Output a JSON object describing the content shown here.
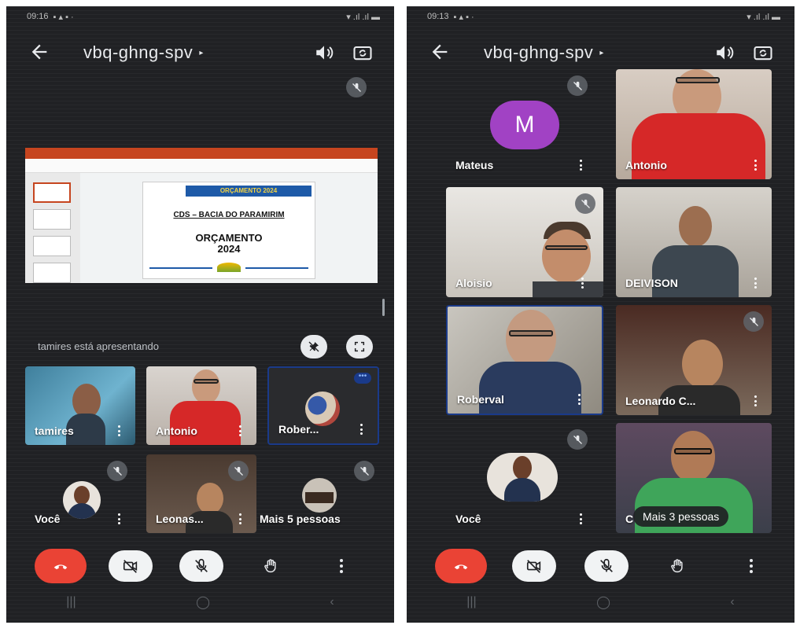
{
  "screens": [
    {
      "status_time": "09:16",
      "room_code": "vbq-ghng-spv",
      "presenter_text": "tamires está apresentando",
      "slide": {
        "banner": "ORÇAMENTO 2024",
        "subtitle": "CDS – BACIA DO PARAMIRIM",
        "title_line1": "ORÇAMENTO",
        "title_line2": "2024"
      },
      "participants": [
        {
          "name": "tamires"
        },
        {
          "name": "Antonio"
        },
        {
          "name": "Rober..."
        },
        {
          "name": "Você"
        },
        {
          "name": "Leonas..."
        },
        {
          "name": "Mais 5 pessoas"
        }
      ]
    },
    {
      "status_time": "09:13",
      "room_code": "vbq-ghng-spv",
      "participants": [
        {
          "name": "Mateus",
          "initial": "M"
        },
        {
          "name": "Antonio"
        },
        {
          "name": "Aloisio"
        },
        {
          "name": "DEIVISON"
        },
        {
          "name": "Roberval"
        },
        {
          "name": "Leonardo C..."
        },
        {
          "name": "Você"
        },
        {
          "name": "C"
        }
      ],
      "more_people": "Mais 3 pessoas"
    }
  ],
  "icons": [
    "back-arrow-icon",
    "speaker-icon",
    "switch-camera-icon",
    "mic-off-icon",
    "end-call-icon",
    "camera-off-icon",
    "raise-hand-icon",
    "more-vert-icon",
    "fullscreen-icon",
    "pin-off-icon"
  ],
  "colors": {
    "background": "#202124",
    "end_call": "#ea4335",
    "avatar_purple": "#a142c4",
    "active_border": "#1a3a8a"
  }
}
